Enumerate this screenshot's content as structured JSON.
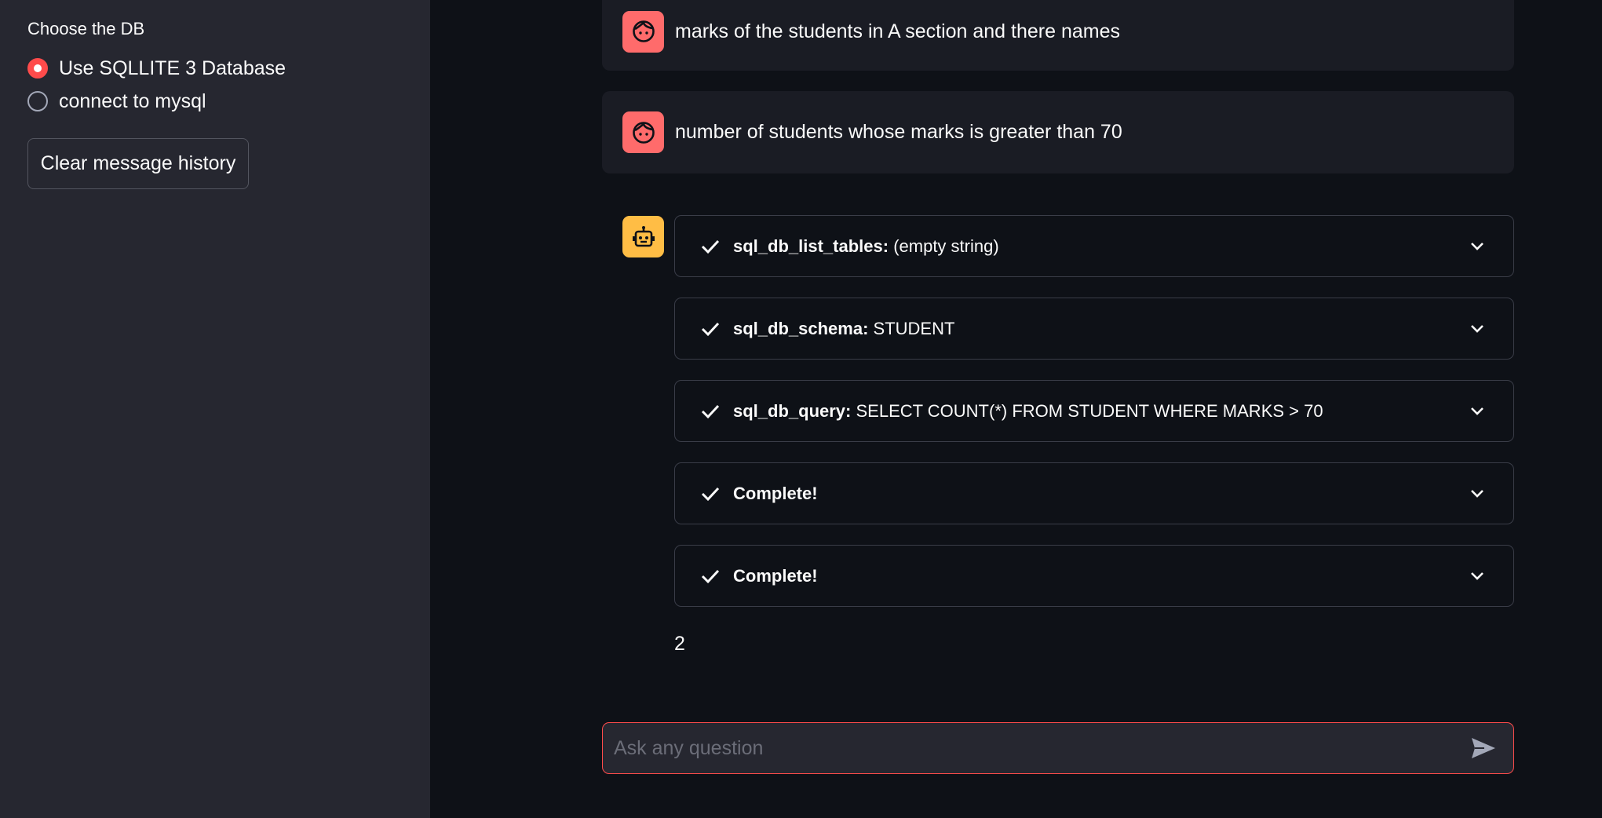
{
  "sidebar": {
    "label": "Choose the DB",
    "options": [
      {
        "label": "Use SQLLITE 3 Database",
        "checked": true
      },
      {
        "label": "connect to mysql",
        "checked": false
      }
    ],
    "clear_button": "Clear message history"
  },
  "chat": {
    "user_messages": [
      {
        "text": "marks of the students in A section and there names",
        "avatar": "user-face-icon"
      },
      {
        "text": "number of students whose marks is greater than 70",
        "avatar": "user-face-icon"
      }
    ],
    "bot_avatar": "robot-icon",
    "steps": [
      {
        "tool": "sql_db_list_tables:",
        "detail": " (empty string)"
      },
      {
        "tool": "sql_db_schema:",
        "detail": " STUDENT"
      },
      {
        "tool": "sql_db_query:",
        "detail": " SELECT COUNT(*) FROM STUDENT WHERE MARKS > 70"
      },
      {
        "tool": "Complete!",
        "detail": ""
      },
      {
        "tool": "Complete!",
        "detail": ""
      }
    ],
    "answer": "2"
  },
  "input": {
    "placeholder": "Ask any question",
    "value": ""
  },
  "colors": {
    "accent": "#ff4b4b",
    "user_avatar": "#ff6b6b",
    "bot_avatar": "#ffbd45",
    "sidebar_bg": "#262730",
    "main_bg": "#0e1117"
  }
}
